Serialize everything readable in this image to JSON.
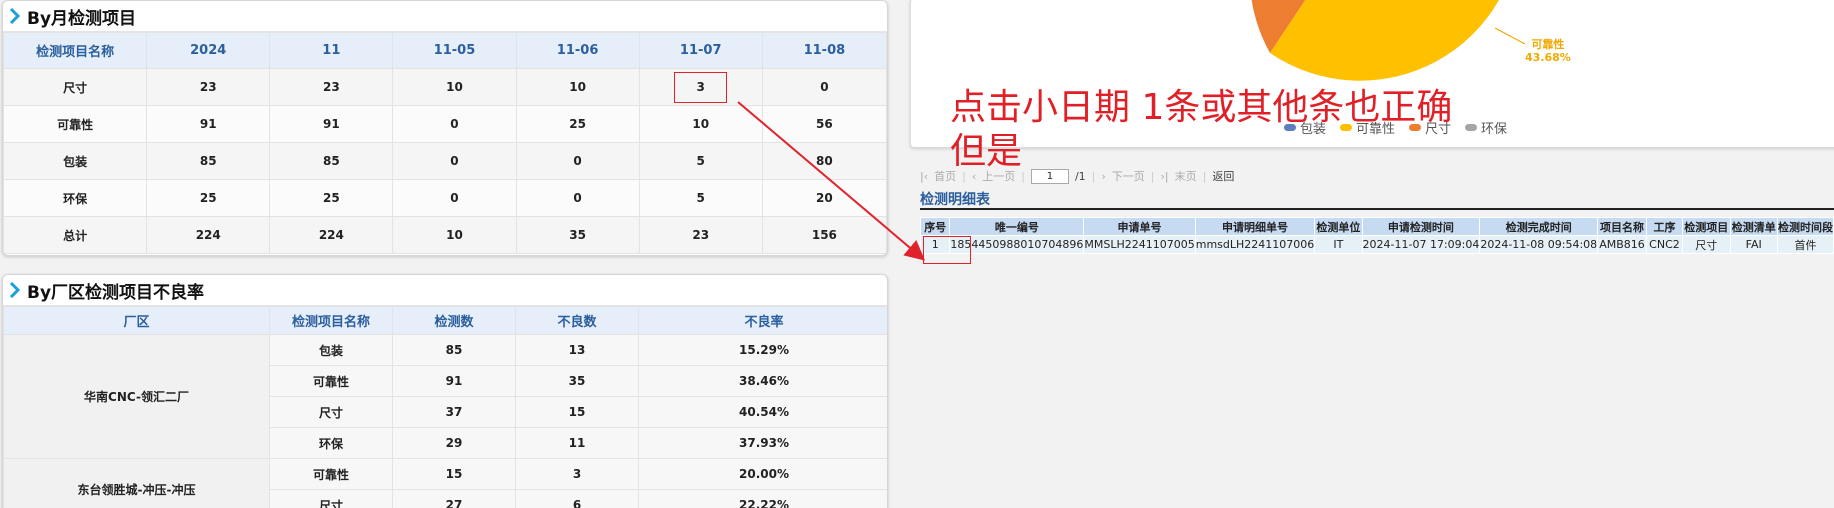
{
  "monthly": {
    "title": "By月检测项目",
    "headers": [
      "检测项目名称",
      "2024",
      "11",
      "11-05",
      "11-06",
      "11-07",
      "11-08"
    ],
    "rows": [
      [
        "尺寸",
        "23",
        "23",
        "10",
        "10",
        "3",
        "0"
      ],
      [
        "可靠性",
        "91",
        "91",
        "0",
        "25",
        "10",
        "56"
      ],
      [
        "包装",
        "85",
        "85",
        "0",
        "0",
        "5",
        "80"
      ],
      [
        "环保",
        "25",
        "25",
        "0",
        "0",
        "5",
        "20"
      ],
      [
        "总计",
        "224",
        "224",
        "10",
        "35",
        "23",
        "156"
      ]
    ]
  },
  "factory": {
    "title": "By厂区检测项目不良率",
    "headers": [
      "厂区",
      "检测项目名称",
      "检测数",
      "不良数",
      "不良率"
    ],
    "groups": [
      {
        "name": "华南CNC-领汇二厂",
        "rows": [
          [
            "包装",
            "85",
            "13",
            "15.29%"
          ],
          [
            "可靠性",
            "91",
            "35",
            "38.46%"
          ],
          [
            "尺寸",
            "37",
            "15",
            "40.54%"
          ],
          [
            "环保",
            "29",
            "11",
            "37.93%"
          ]
        ]
      },
      {
        "name": "东台领胜城-冲压-冲压",
        "rows": [
          [
            "可靠性",
            "15",
            "3",
            "20.00%"
          ],
          [
            "尺寸",
            "27",
            "6",
            "22.22%"
          ]
        ]
      }
    ]
  },
  "pie": {
    "label_name": "可靠性",
    "label_pct": "43.68%",
    "legend": [
      {
        "name": "包装",
        "color": "#5b7fbf"
      },
      {
        "name": "可靠性",
        "color": "#ffc000"
      },
      {
        "name": "尺寸",
        "color": "#ed7d31"
      },
      {
        "name": "环保",
        "color": "#a5a5a5"
      }
    ]
  },
  "annotation": {
    "line1": "点击小日期 1条或其他条也正确",
    "line2": "但是"
  },
  "pager": {
    "first": "首页",
    "prev": "上一页",
    "page_value": "1",
    "total": "/1",
    "next": "下一页",
    "last": "末页",
    "back": "返回"
  },
  "detail": {
    "title": "检测明细表",
    "headers": [
      "序号",
      "唯一编号",
      "申请单号",
      "申请明细单号",
      "检测单位",
      "申请检测时间",
      "检测完成时间",
      "项目名称",
      "工序",
      "检测项目",
      "检测清单",
      "检测时间段"
    ],
    "rows": [
      [
        "1",
        "1854450988010704896",
        "MMSLH2241107005",
        "mmsdLH2241107006",
        "IT",
        "2024-11-07 17:09:04",
        "2024-11-08 09:54:08",
        "AMB816",
        "CNC2",
        "尺寸",
        "FAI",
        "首件"
      ]
    ]
  }
}
